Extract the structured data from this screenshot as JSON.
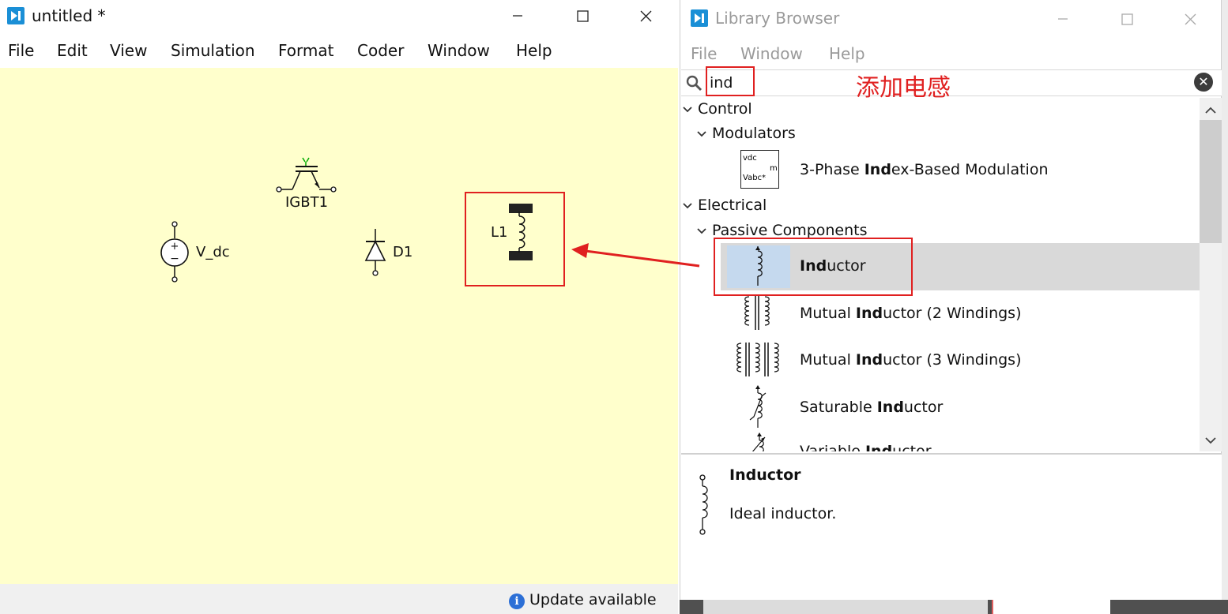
{
  "left_window": {
    "title": "untitled *",
    "menu": [
      "File",
      "Edit",
      "View",
      "Simulation",
      "Format",
      "Coder",
      "Window",
      "Help"
    ],
    "components": {
      "igbt": "IGBT1",
      "vdc": "V_dc",
      "diode": "D1",
      "inductor": "L1"
    },
    "status": "Update available",
    "status_icon": "info-icon"
  },
  "right_window": {
    "title": "Library Browser",
    "menu": [
      "File",
      "Window",
      "Help"
    ],
    "search": {
      "value": "ind",
      "placeholder": ""
    },
    "annotation": "添加电感",
    "tree": {
      "control": "Control",
      "modulators": "Modulators",
      "mod_item": {
        "pre": "3-Phase ",
        "match": "Ind",
        "post": "ex-Based Modulation",
        "icon_labels": [
          "vdc",
          "m",
          "Vabc*"
        ]
      },
      "electrical": "Electrical",
      "passive": "Passive Components",
      "items": [
        {
          "pre": "",
          "match": "Ind",
          "post": "uctor",
          "icon": "inductor-icon"
        },
        {
          "pre": "Mutual ",
          "match": "Ind",
          "post": "uctor (2 Windings)",
          "icon": "mutual-inductor-2-icon"
        },
        {
          "pre": "Mutual ",
          "match": "Ind",
          "post": "uctor (3 Windings)",
          "icon": "mutual-inductor-3-icon"
        },
        {
          "pre": "Saturable ",
          "match": "Ind",
          "post": "uctor",
          "icon": "saturable-inductor-icon"
        },
        {
          "pre": "Variable ",
          "match": "Ind",
          "post": "uctor",
          "icon": "variable-inductor-icon"
        }
      ]
    },
    "description": {
      "title": "Inductor",
      "text": "Ideal inductor."
    }
  },
  "colors": {
    "canvas": "#ffffcc",
    "annotation": "#e02020",
    "selection": "#d9d9d9",
    "accent": "#1a8fd6"
  }
}
